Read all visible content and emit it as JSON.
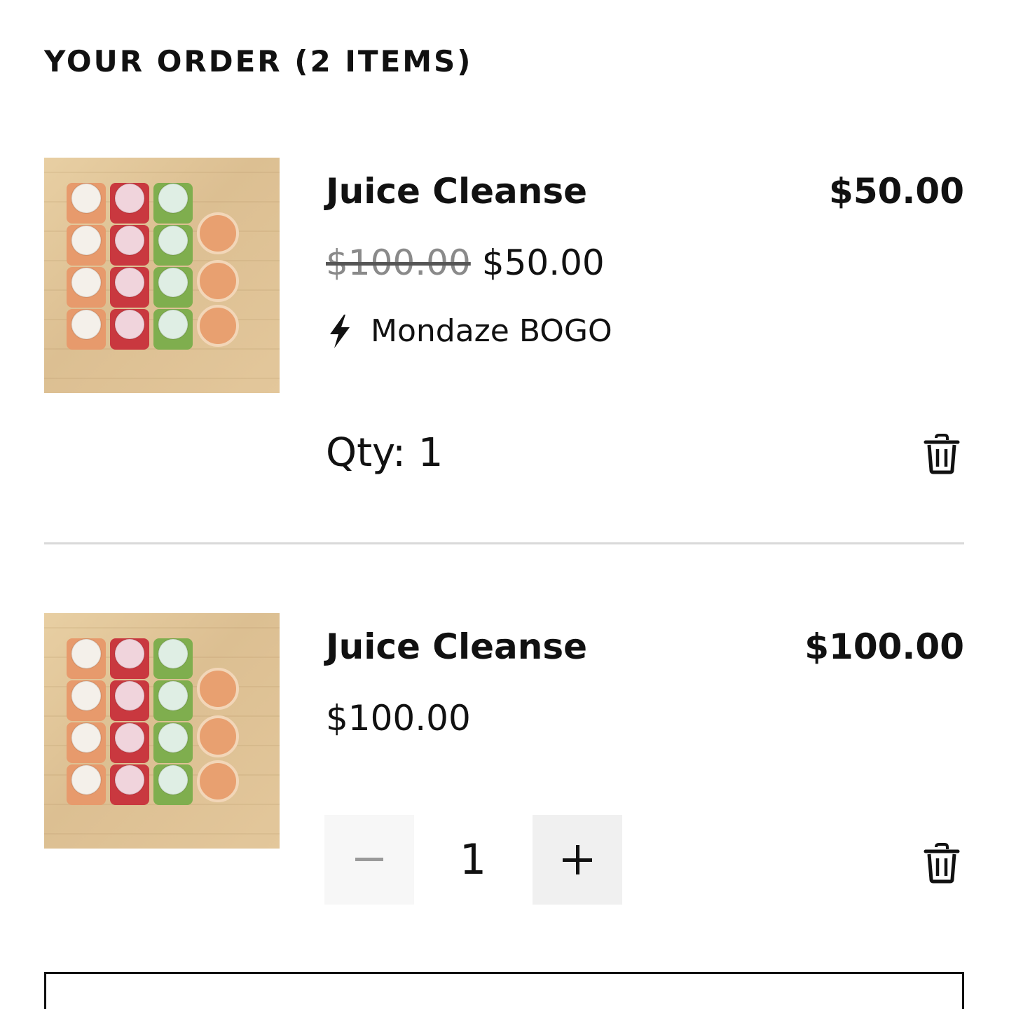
{
  "order": {
    "heading": "YOUR ORDER (2 ITEMS)"
  },
  "items": [
    {
      "name": "Juice Cleanse",
      "line_total": "$50.00",
      "original_price": "$100.00",
      "sale_price": "$50.00",
      "promo_label": "Mondaze BOGO",
      "promo_icon": "lightning-bolt-icon",
      "qty_label": "Qty: 1",
      "remove_icon": "trash-icon"
    },
    {
      "name": "Juice Cleanse",
      "line_total": "$100.00",
      "price": "$100.00",
      "quantity": "1",
      "decrement_icon": "minus-icon",
      "increment_icon": "plus-icon",
      "remove_icon": "trash-icon"
    }
  ]
}
